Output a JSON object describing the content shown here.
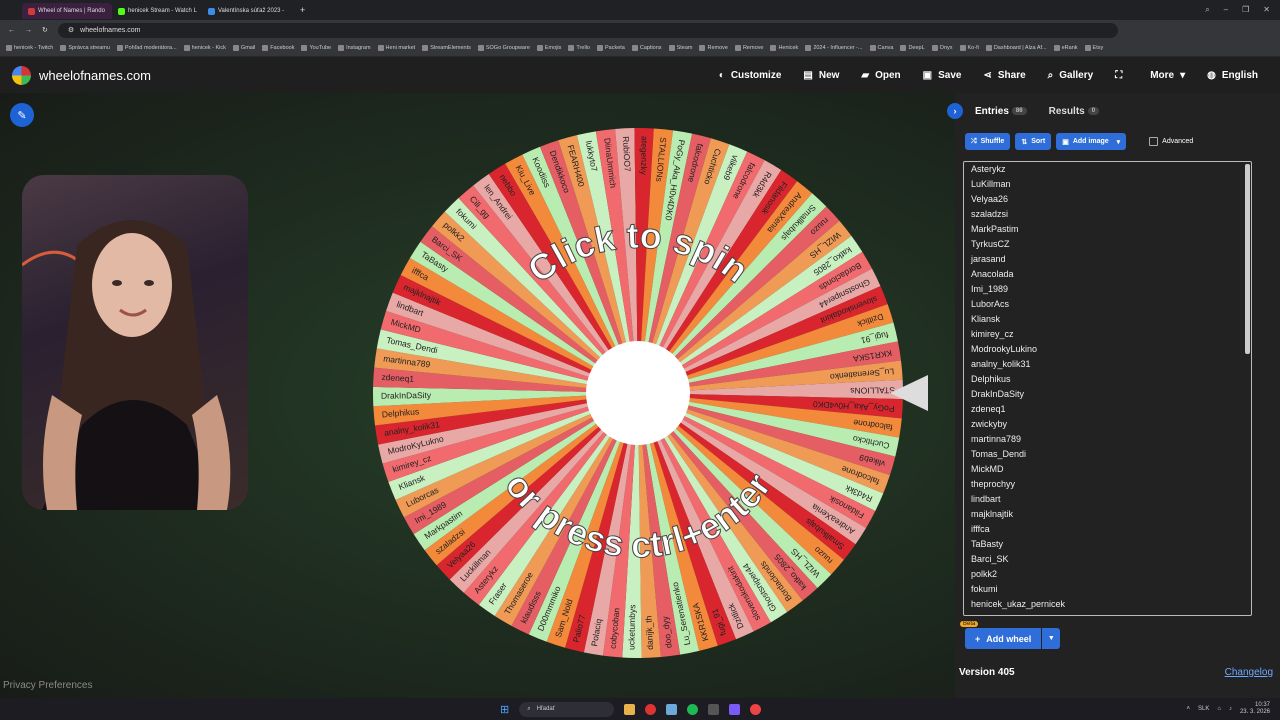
{
  "browser": {
    "tabs": [
      {
        "label": "Wheel of Names | Rando",
        "color": "#d23a3a",
        "active": true
      },
      {
        "label": "henicek Stream - Watch L",
        "color": "#53fc18",
        "active": false
      },
      {
        "label": "Valentínska súťaž 2023 - ",
        "color": "#3b8ee8",
        "active": false
      }
    ],
    "url": "wheelofnames.com",
    "bookmarks": [
      "henicek - Twitch",
      "Správca streamu",
      "Pohľad moderátora...",
      "henicek - Kick",
      "Gmail",
      "Facebook",
      "YouTube",
      "Instagram",
      "Heni market",
      "StreamElements",
      "SOGo Groupware",
      "Emojis",
      "Trello",
      "Packeta",
      "Captions",
      "Steam",
      "Remove",
      "Remove",
      "Henicek",
      "2024 - Influencer -...",
      "Canva",
      "DeepL",
      "Onyx",
      "Ko-fi",
      "Dashboard | Alza Af...",
      "eRank",
      "Etsy"
    ]
  },
  "nav": {
    "site_name": "wheelofnames.com",
    "items": [
      {
        "label": "Customize",
        "icon": "palette-icon"
      },
      {
        "label": "New",
        "icon": "file-icon"
      },
      {
        "label": "Open",
        "icon": "folder-icon"
      },
      {
        "label": "Save",
        "icon": "save-icon"
      },
      {
        "label": "Share",
        "icon": "share-icon"
      },
      {
        "label": "Gallery",
        "icon": "search-icon"
      },
      {
        "label": "",
        "icon": "fullscreen-icon"
      },
      {
        "label": "More",
        "icon": "chevron-down-icon"
      },
      {
        "label": "English",
        "icon": "globe-icon"
      }
    ]
  },
  "wheel": {
    "top_text": "Click to spin",
    "bottom_text": "or press ctrl+enter",
    "slice_colors": [
      "#e8a8a6",
      "#d9262e",
      "#f3893a",
      "#b9ecb0",
      "#e45e64",
      "#ef9a55",
      "#c8f0c0",
      "#f06a6e"
    ],
    "visible_slice_labels": [
      "STALLIONs",
      "PoGy_Aka_H0v4DK0",
      "falcodrone",
      "Cuchticko",
      "vlikeb9",
      "falcodrone",
      "R4d3kk",
      "Fildanosik",
      "AndreaXenia",
      "Smallkubajs",
      "ruuzo",
      "WIZL_HS",
      "katko_2805",
      "Bordaclonds",
      "Ghostsniper44",
      "slovenskodakirit",
      "Dzitlick",
      "fugi_91",
      "KKR1SKA",
      "Lu_Serenatienko",
      "doo_dyy",
      "danijk_th",
      "ucketumbys",
      "cobycoban",
      "Polaciq",
      "Palio77",
      "Sam_Nold",
      "D00mmmiko",
      "klaudisss",
      "Thomaseroe",
      "Fraser",
      "Asterykz",
      "Luckillman",
      "Velyaa26",
      "szaladzsi",
      "Markpastim",
      "Imi_1989",
      "Luborcas",
      "Kliansk",
      "kimirey_cz",
      "ModroKyLukno",
      "analny_kolik31",
      "Delphikus",
      "DrakInDaSity",
      "zdeneq1",
      "martinna789",
      "Tomas_Dendi",
      "MickMD",
      "lindbart",
      "majklnajtik",
      "ifffca",
      "TaBasty",
      "Barci_SK",
      "polkk2",
      "fokumi",
      "Cili_gg",
      "len_Andrei",
      "nebbo",
      "Kiu_Live",
      "Koodiiss",
      "Dendikkoco",
      "FEARH400",
      "lukkyto7",
      "DiinaUmmich",
      "RubiOO7",
      "ategenzky"
    ]
  },
  "sidebar": {
    "entries_label": "Entries",
    "entries_count": "86",
    "results_label": "Results",
    "results_count": "0",
    "shuffle_label": "Shuffle",
    "sort_label": "Sort",
    "add_image_label": "Add image",
    "advanced_label": "Advanced",
    "entries": [
      "Asterykz",
      "LuKillman",
      "Velyaa26",
      "szaladzsi",
      "MarkPastim",
      "TyrkusCZ",
      "jarasand",
      "Anacolada",
      "Imi_1989",
      "LuborAcs",
      "Kliansk",
      "kimirey_cz",
      "ModrookyLukino",
      "analny_kolik31",
      "Delphikus",
      "DrakInDaSity",
      "zdeneq1",
      "zwickyby",
      "martinna789",
      "Tomas_Dendi",
      "MickMD",
      "theprochyy",
      "lindbart",
      "majklnajtik",
      "ifffca",
      "TaBasty",
      "Barci_SK",
      "polkk2",
      "fokumi",
      "henicek_ukaz_pernicek"
    ],
    "beta_label": "Beta",
    "add_wheel_label": "Add wheel",
    "version_label": "Version 405",
    "changelog_label": "Changelog"
  },
  "footer": {
    "privacy_label": "Privacy Preferences"
  },
  "taskbar": {
    "search_label": "Hľadať",
    "lang": "SLK",
    "time": "10:37",
    "date": "23. 3. 2026"
  }
}
